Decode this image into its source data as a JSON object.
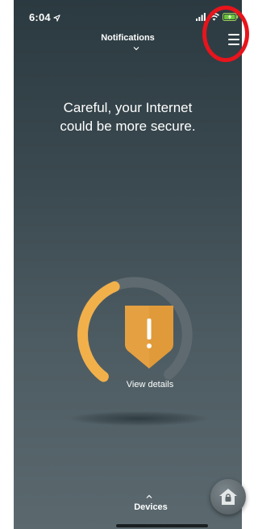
{
  "status_bar": {
    "time": "6:04"
  },
  "header": {
    "title": "Notifications"
  },
  "alert": {
    "line1": "Careful, your Internet",
    "line2": "could be more secure."
  },
  "security_gauge": {
    "level": 0.38,
    "fill_color": "#f2b04b",
    "track_color": "#5e6a6f",
    "view_details_label": "View details"
  },
  "shield": {
    "symbol": "!",
    "color": "#e09a3a"
  },
  "footer": {
    "devices_label": "Devices"
  },
  "icons": [
    "location-arrow-icon",
    "signal-icon",
    "wifi-icon",
    "battery-charging-icon",
    "hamburger-menu-icon",
    "chevron-down-icon",
    "warning-shield-icon",
    "chevron-up-icon",
    "house-lock-icon"
  ],
  "annotation": {
    "color": "#e8141c"
  }
}
